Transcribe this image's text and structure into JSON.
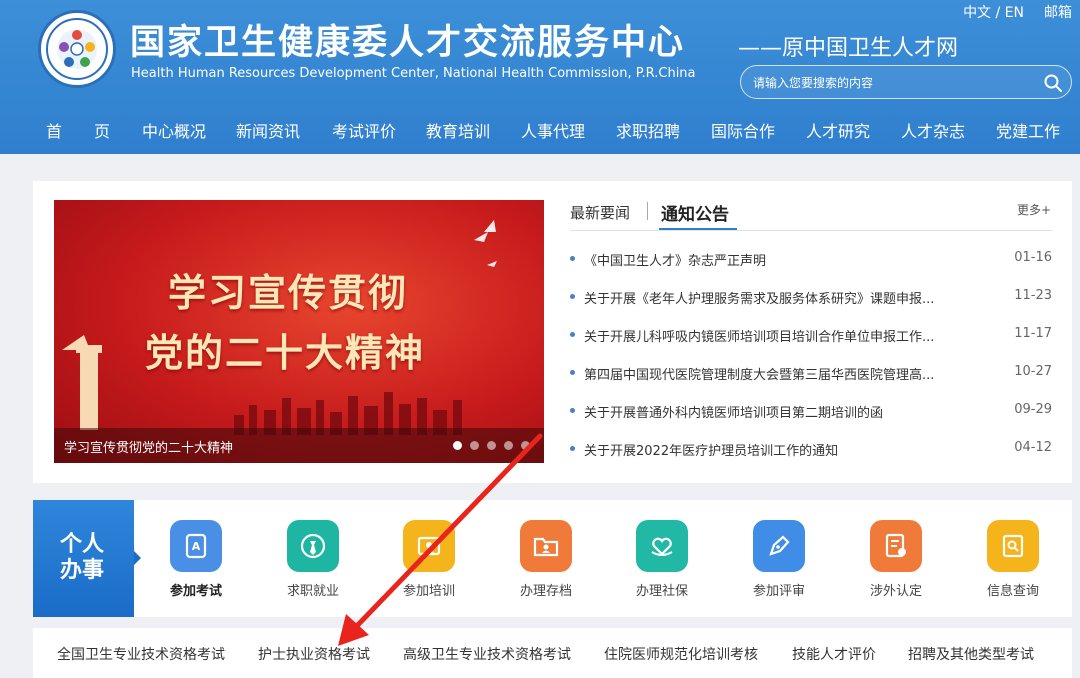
{
  "header": {
    "title_cn": "国家卫生健康委人才交流服务中心",
    "title_en": "Health Human Resources Development Center, National Health Commission, P.R.China",
    "subtitle": "——原中国卫生人才网",
    "lang_link": "中文 / EN",
    "mail_link": "邮箱",
    "search_placeholder": "请输入您要搜索的内容"
  },
  "nav": [
    "首　　页",
    "中心概况",
    "新闻资讯",
    "考试评价",
    "教育培训",
    "人事代理",
    "求职招聘",
    "国际合作",
    "人才研究",
    "人才杂志",
    "党建工作"
  ],
  "banner": {
    "line1": "学习宣传贯彻",
    "line2": "党的二十大精神",
    "caption": "学习宣传贯彻党的二十大精神",
    "slide_count": 5,
    "active_slide": 1
  },
  "news": {
    "tab_latest": "最新要闻",
    "tab_notice": "通知公告",
    "more": "更多+",
    "items": [
      {
        "title": "《中国卫生人才》杂志严正声明",
        "date": "01-16"
      },
      {
        "title": "关于开展《老年人护理服务需求及服务体系研究》课题申报...",
        "date": "11-23"
      },
      {
        "title": "关于开展儿科呼吸内镜医师培训项目培训合作单位申报工作...",
        "date": "11-17"
      },
      {
        "title": "第四届中国现代医院管理制度大会暨第三届华西医院管理高...",
        "date": "10-27"
      },
      {
        "title": "关于开展普通外科内镜医师培训项目第二期培训的函",
        "date": "09-29"
      },
      {
        "title": "关于开展2022年医疗护理员培训工作的通知",
        "date": "04-12"
      }
    ]
  },
  "services": {
    "tab_label": "个人办事",
    "items": [
      {
        "label": "参加考试",
        "icon": "exam-icon",
        "color": "#4a8fe6"
      },
      {
        "label": "求职就业",
        "icon": "job-icon",
        "color": "#1fb5a3"
      },
      {
        "label": "参加培训",
        "icon": "training-icon",
        "color": "#f5b31c"
      },
      {
        "label": "办理存档",
        "icon": "archive-icon",
        "color": "#f07a3a"
      },
      {
        "label": "办理社保",
        "icon": "insurance-icon",
        "color": "#21b8a6"
      },
      {
        "label": "参加评审",
        "icon": "review-icon",
        "color": "#3f8de6"
      },
      {
        "label": "涉外认定",
        "icon": "foreign-icon",
        "color": "#f07a3a"
      },
      {
        "label": "信息查询",
        "icon": "query-icon",
        "color": "#f5b31c"
      }
    ]
  },
  "exams": [
    "全国卫生专业技术资格考试",
    "护士执业资格考试",
    "高级卫生专业技术资格考试",
    "住院医师规范化培训考核",
    "技能人才评价",
    "招聘及其他类型考试"
  ],
  "colors": {
    "header": "#2f7fce",
    "accent": "#1a6cc6",
    "annotation_arrow": "#e8241d"
  }
}
